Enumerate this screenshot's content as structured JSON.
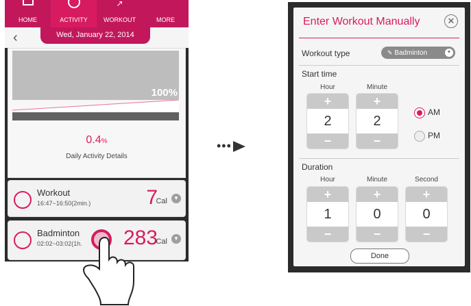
{
  "left_phone": {
    "nav": [
      "HOME",
      "ACTIVITY",
      "WORKOUT",
      "MORE"
    ],
    "date": "Wed, January 22, 2014",
    "progress_label": "100%",
    "percent_value": "0.4",
    "percent_unit": "%",
    "details_label": "Daily Activity Details",
    "rows": [
      {
        "title": "Workout",
        "time": "16:47~16:50(2min.)",
        "value": "7",
        "unit": "Cal",
        "icon": "clock-icon"
      },
      {
        "title": "Badminton",
        "time": "02:02~03:02(1h.",
        "value": "283",
        "unit": "Cal",
        "icon": "badminton-icon"
      }
    ]
  },
  "dialog": {
    "title": "Enter Workout Manually",
    "workout_type_label": "Workout type",
    "workout_type_value": "Badminton",
    "start_time_label": "Start time",
    "start_cols": [
      "Hour",
      "Minute"
    ],
    "start_values": [
      "2",
      "2"
    ],
    "am_label": "AM",
    "pm_label": "PM",
    "am_selected": true,
    "duration_label": "Duration",
    "duration_cols": [
      "Hour",
      "Minute",
      "Second"
    ],
    "duration_values": [
      "1",
      "0",
      "0"
    ],
    "done_label": "Done"
  },
  "colors": {
    "accent": "#d81b60",
    "nav": "#c2185b",
    "stepper": "#c9c9c9"
  }
}
